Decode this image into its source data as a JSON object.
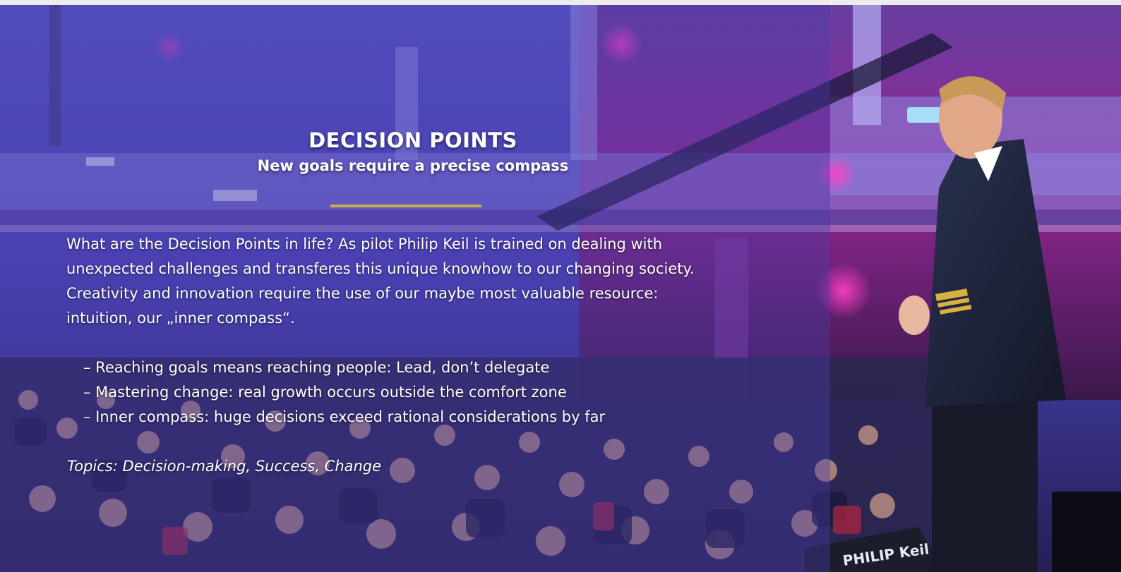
{
  "section": {
    "title": "DECISION POINTS",
    "subtitle": "New goals require a precise compass",
    "body": [
      "What are the Decision Points in life? As pilot Philip Keil is trained on dealing with",
      "unexpected challenges and transferes this unique knowhow to our changing society.",
      "Creativity and innovation require the use of our maybe most valuable resource:",
      "intuition, our „inner compass“."
    ],
    "bullets": [
      "– Reaching goals means reaching people: Lead, don’t delegate",
      "– Mastering change: real growth occurs outside the comfort zone",
      "– Inner compass: huge decisions exceed rational considerations by far"
    ],
    "topics": "Topics: Decision-making, Success, Change"
  },
  "photo": {
    "description_icon": "stage-speaker-photo-icon",
    "podium_text": "PHILIP Keil"
  },
  "colors": {
    "accent": "#c9a94a",
    "overlay": "#463caa"
  }
}
